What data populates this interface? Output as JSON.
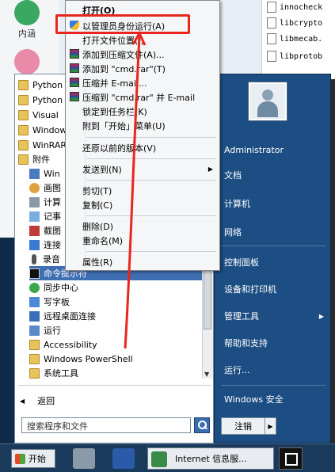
{
  "desktop": {
    "icons": [
      {
        "label": "内涵",
        "icon": "app-icon-green",
        "color": "#3aa860"
      },
      {
        "label": "",
        "icon": "bear-icon",
        "color": "#e88aa8"
      }
    ],
    "files": [
      {
        "name": "innocheck"
      },
      {
        "name": "libcrypto"
      },
      {
        "name": "libmecab."
      },
      {
        "name": "libprotob"
      }
    ]
  },
  "start_menu": {
    "programs": [
      {
        "label": "Python",
        "icon": "folder-icon"
      },
      {
        "label": "Python",
        "icon": "folder-icon"
      },
      {
        "label": "Visual",
        "icon": "folder-icon"
      },
      {
        "label": "Window",
        "icon": "folder-icon"
      },
      {
        "label": "WinRAR",
        "icon": "folder-icon"
      },
      {
        "label": "附件",
        "icon": "folder-icon"
      },
      {
        "label": "Win",
        "icon": "app-icon"
      },
      {
        "label": "画图",
        "icon": "paint-icon"
      },
      {
        "label": "计算",
        "icon": "calculator-icon"
      },
      {
        "label": "记事",
        "icon": "notepad-icon"
      },
      {
        "label": "截图",
        "icon": "snipping-icon"
      },
      {
        "label": "连接",
        "icon": "projector-icon"
      },
      {
        "label": "录音",
        "icon": "microphone-icon"
      },
      {
        "label": "命令提示符",
        "icon": "cmd-icon"
      },
      {
        "label": "同步中心",
        "icon": "sync-icon"
      },
      {
        "label": "写字板",
        "icon": "wordpad-icon"
      },
      {
        "label": "远程桌面连接",
        "icon": "remote-desktop-icon"
      },
      {
        "label": "运行",
        "icon": "run-icon"
      },
      {
        "label": "Accessibility",
        "icon": "folder-icon"
      },
      {
        "label": "Windows PowerShell",
        "icon": "folder-icon"
      },
      {
        "label": "系统工具",
        "icon": "folder-icon"
      }
    ],
    "selected_program": "命令提示符",
    "back_label": "返回",
    "search_placeholder": "搜索程序和文件",
    "right_items": [
      {
        "label": "Administrator",
        "submenu": false
      },
      {
        "label": "文档",
        "submenu": false
      },
      {
        "label": "计算机",
        "submenu": false
      },
      {
        "label": "网络",
        "submenu": false
      },
      {
        "label": "控制面板",
        "submenu": false
      },
      {
        "label": "设备和打印机",
        "submenu": false
      },
      {
        "label": "管理工具",
        "submenu": true
      },
      {
        "label": "帮助和支持",
        "submenu": false
      },
      {
        "label": "运行...",
        "submenu": false
      },
      {
        "label": "Windows 安全",
        "submenu": false
      }
    ],
    "power_label": "注销"
  },
  "context_menu": {
    "items": [
      {
        "label": "打开(O)",
        "icon": "",
        "bold": true,
        "submenu": false
      },
      {
        "label": "以管理员身份运行(A)",
        "icon": "shield-icon",
        "bold": false,
        "submenu": false
      },
      {
        "label": "打开文件位置(I)",
        "icon": "",
        "bold": false,
        "submenu": false
      },
      {
        "label": "添加到压缩文件(A)...",
        "icon": "winrar-icon",
        "bold": false,
        "submenu": false
      },
      {
        "label": "添加到 \"cmd.rar\"(T)",
        "icon": "winrar-icon",
        "bold": false,
        "submenu": false
      },
      {
        "label": "压缩并 E-mail...",
        "icon": "winrar-icon",
        "bold": false,
        "submenu": false
      },
      {
        "label": "压缩到 \"cmd.rar\" 并 E-mail",
        "icon": "winrar-icon",
        "bold": false,
        "submenu": false
      },
      {
        "label": "锁定到任务栏(K)",
        "icon": "",
        "bold": false,
        "submenu": false
      },
      {
        "label": "附到「开始」菜单(U)",
        "icon": "",
        "bold": false,
        "submenu": false
      },
      {
        "label": "还原以前的版本(V)",
        "icon": "",
        "bold": false,
        "submenu": false
      },
      {
        "label": "发送到(N)",
        "icon": "",
        "bold": false,
        "submenu": true
      },
      {
        "label": "剪切(T)",
        "icon": "",
        "bold": false,
        "submenu": false
      },
      {
        "label": "复制(C)",
        "icon": "",
        "bold": false,
        "submenu": false
      },
      {
        "label": "删除(D)",
        "icon": "",
        "bold": false,
        "submenu": false
      },
      {
        "label": "重命名(M)",
        "icon": "",
        "bold": false,
        "submenu": false
      },
      {
        "label": "属性(R)",
        "icon": "",
        "bold": false,
        "submenu": false
      }
    ],
    "highlight_color": "#e8261e"
  },
  "taskbar": {
    "start_label": "开始",
    "task_label": "Internet 信息服..."
  }
}
